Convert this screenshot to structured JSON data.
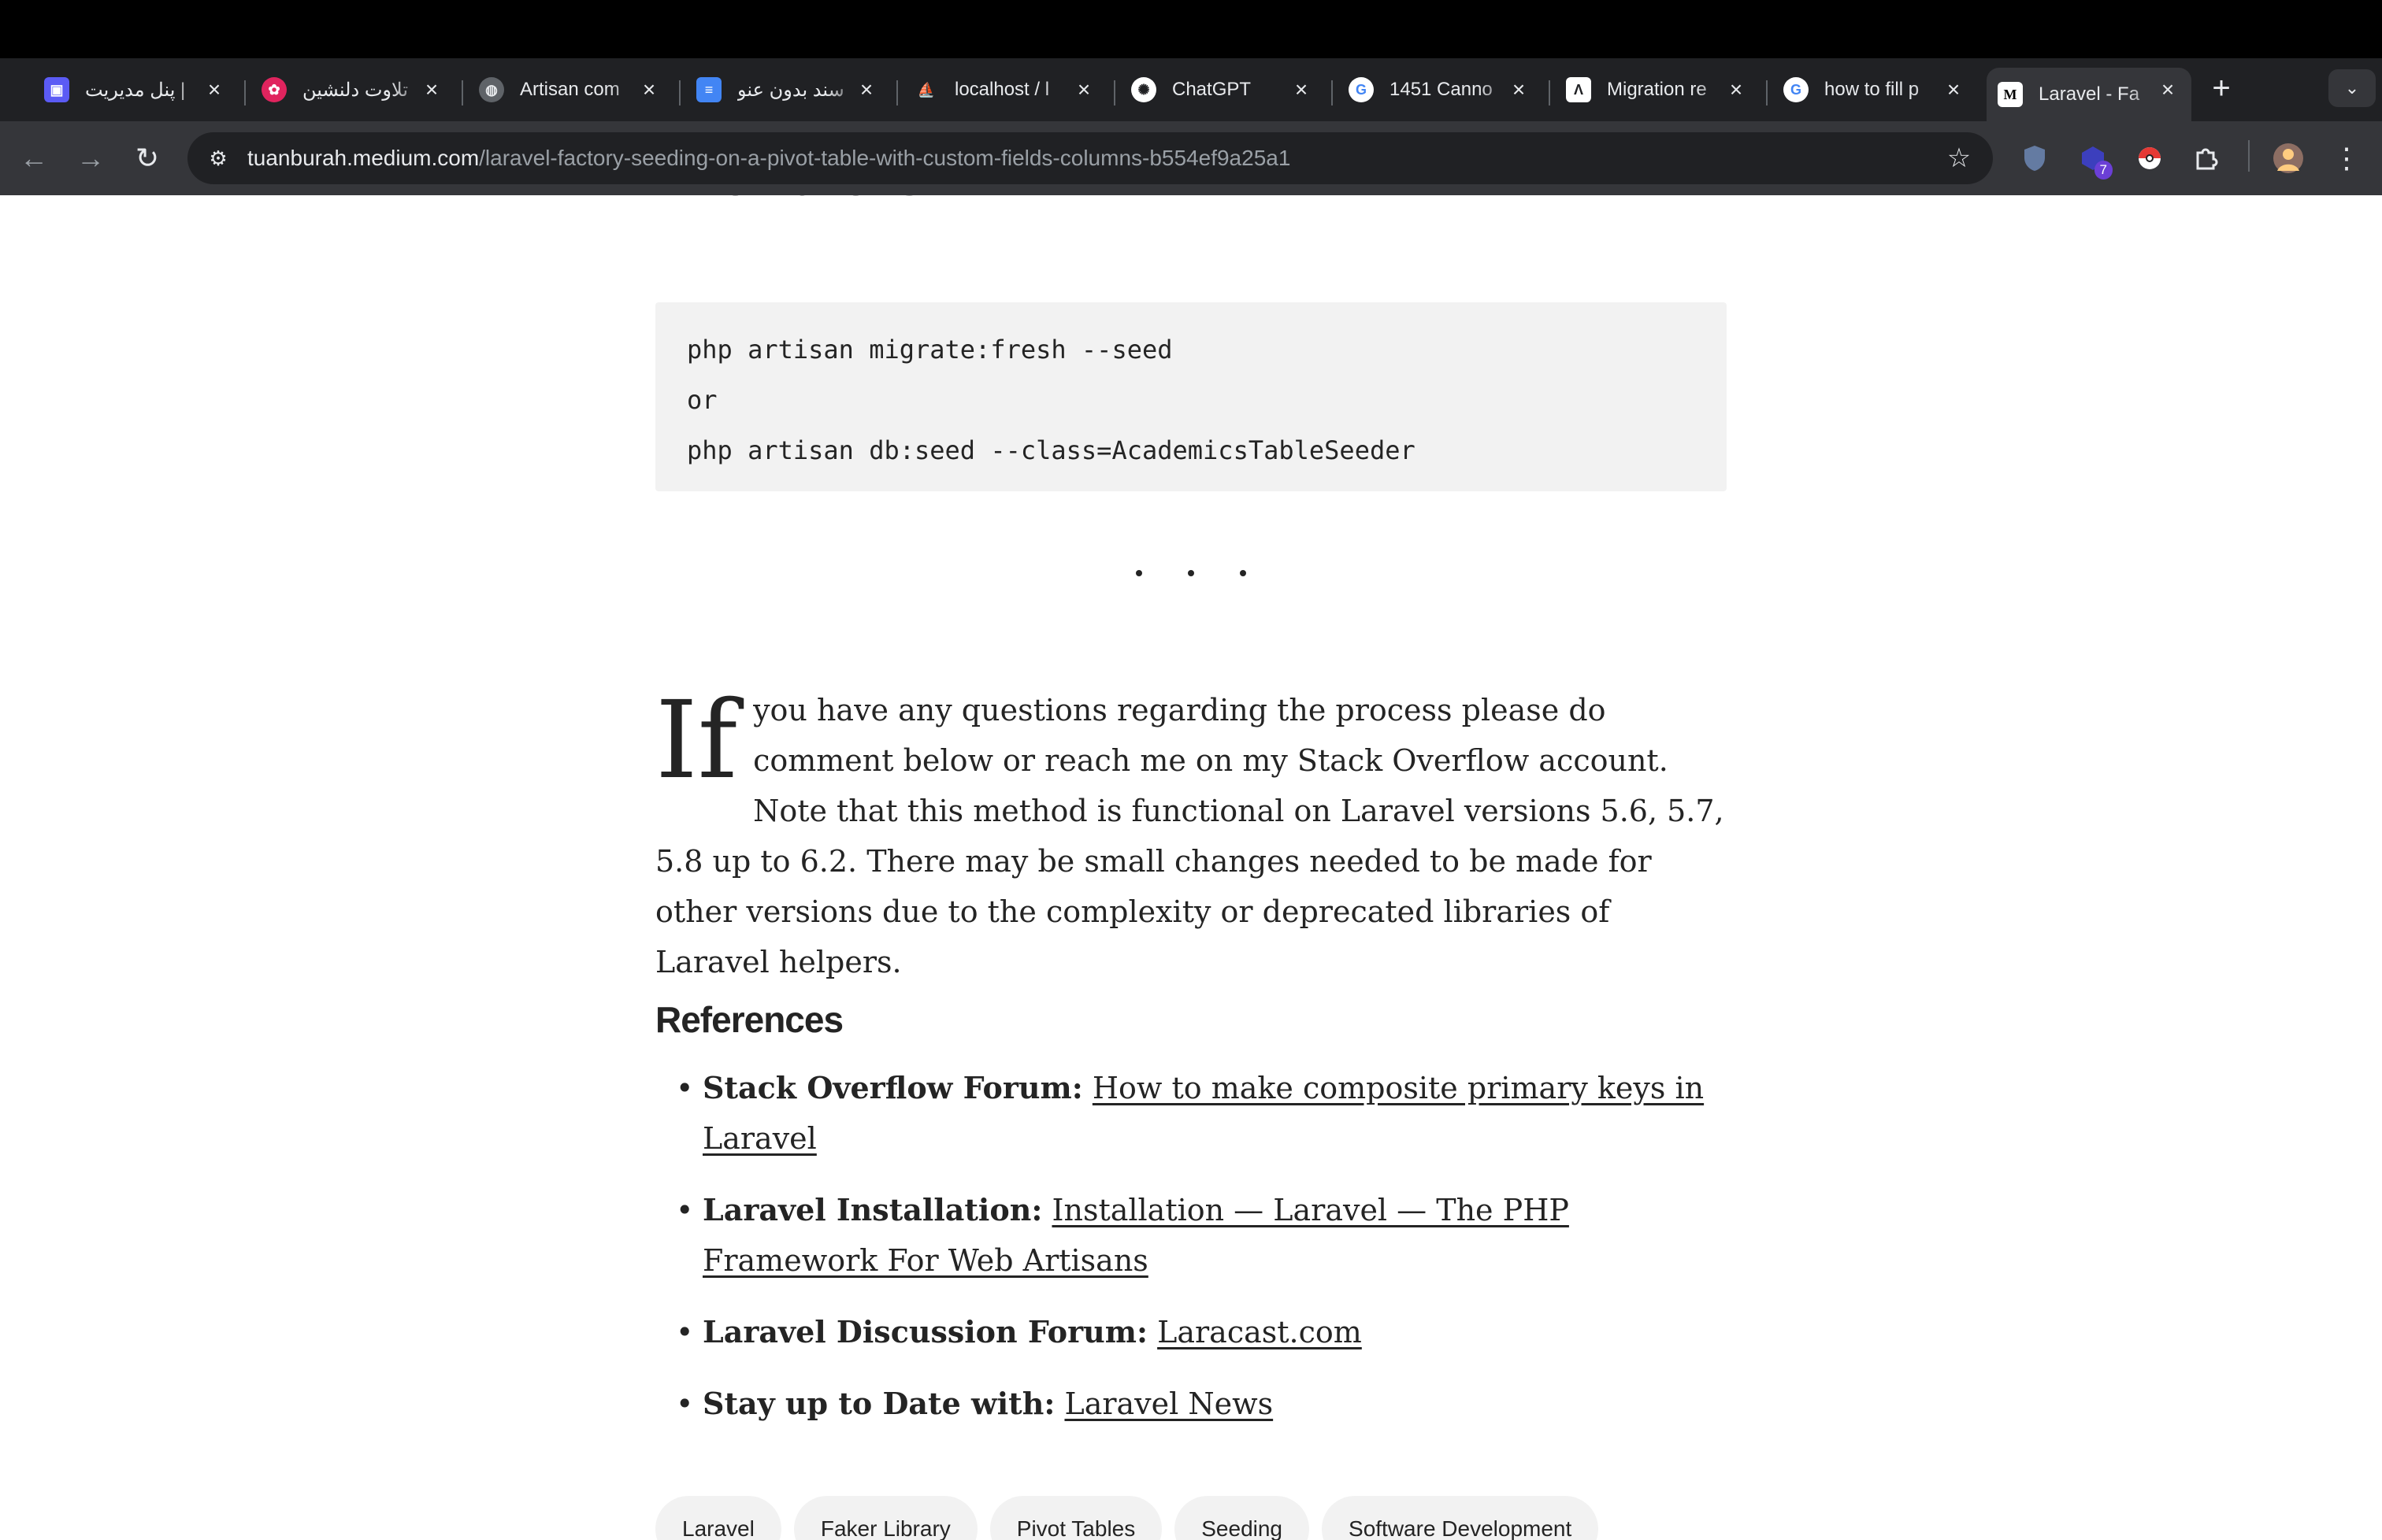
{
  "browser": {
    "tabs": [
      {
        "title": "پنل مدیریت |",
        "favicon": "app-logo-purple",
        "color": "#5b5bf5",
        "glyph": "▣"
      },
      {
        "title": "تلاوت دلنشین",
        "favicon": "red-flower-logo",
        "color": "#e0245e",
        "glyph": "✿"
      },
      {
        "title": "Artisan com",
        "favicon": "globe-icon",
        "color": "#5f6368",
        "glyph": "◍"
      },
      {
        "title": "سند بدون عنو",
        "favicon": "docs-icon",
        "color": "#4285f4",
        "glyph": "≡"
      },
      {
        "title": "localhost / l",
        "favicon": "phpmyadmin-icon",
        "color": "#f29111",
        "glyph": "⛵"
      },
      {
        "title": "ChatGPT",
        "favicon": "openai-icon",
        "color": "#ffffff",
        "glyph": "✺"
      },
      {
        "title": "1451 Canno",
        "favicon": "google-icon",
        "color": "#ffffff",
        "glyph": "G"
      },
      {
        "title": "Migration re",
        "favicon": "a-logo-icon",
        "color": "#ffffff",
        "glyph": "Λ"
      },
      {
        "title": "how to fill p",
        "favicon": "google-icon",
        "color": "#ffffff",
        "glyph": "G"
      },
      {
        "title": "Laravel - Fa",
        "favicon": "medium-icon",
        "color": "#ffffff",
        "glyph": "M"
      }
    ],
    "new_tab": "+",
    "tab_search": "⌄",
    "url_host": "tuanburah.medium.com",
    "url_path": "/laravel-factory-seeding-on-a-pivot-table-with-custom-fields-columns-b554ef9a25a1",
    "extension_badge": "7"
  },
  "article": {
    "previous_line": "how it works.",
    "code_lines": [
      "php artisan migrate:fresh --seed",
      "or",
      "php artisan db:seed --class=AcademicsTableSeeder"
    ],
    "dropcap": "If",
    "paragraph": "you have any questions regarding the process please do comment below or reach me on my Stack Overflow account. Note that this method is functional on Laravel versions 5.6, 5.7, 5.8 up to 6.2. There may be small changes needed to be made for other versions due to the complexity or deprecated libraries of Laravel helpers.",
    "references_heading": "References",
    "references": [
      {
        "label": "Stack Overflow Forum:",
        "link": "How to make composite primary keys in Laravel"
      },
      {
        "label": "Laravel Installation:",
        "link": "Installation — Laravel — The PHP Framework For Web Artisans"
      },
      {
        "label": "Laravel Discussion Forum:",
        "link": "Laracast.com"
      },
      {
        "label": "Stay up to Date with:",
        "link": "Laravel News"
      }
    ],
    "tags": [
      "Laravel",
      "Faker Library",
      "Pivot Tables",
      "Seeding",
      "Software Development"
    ]
  }
}
